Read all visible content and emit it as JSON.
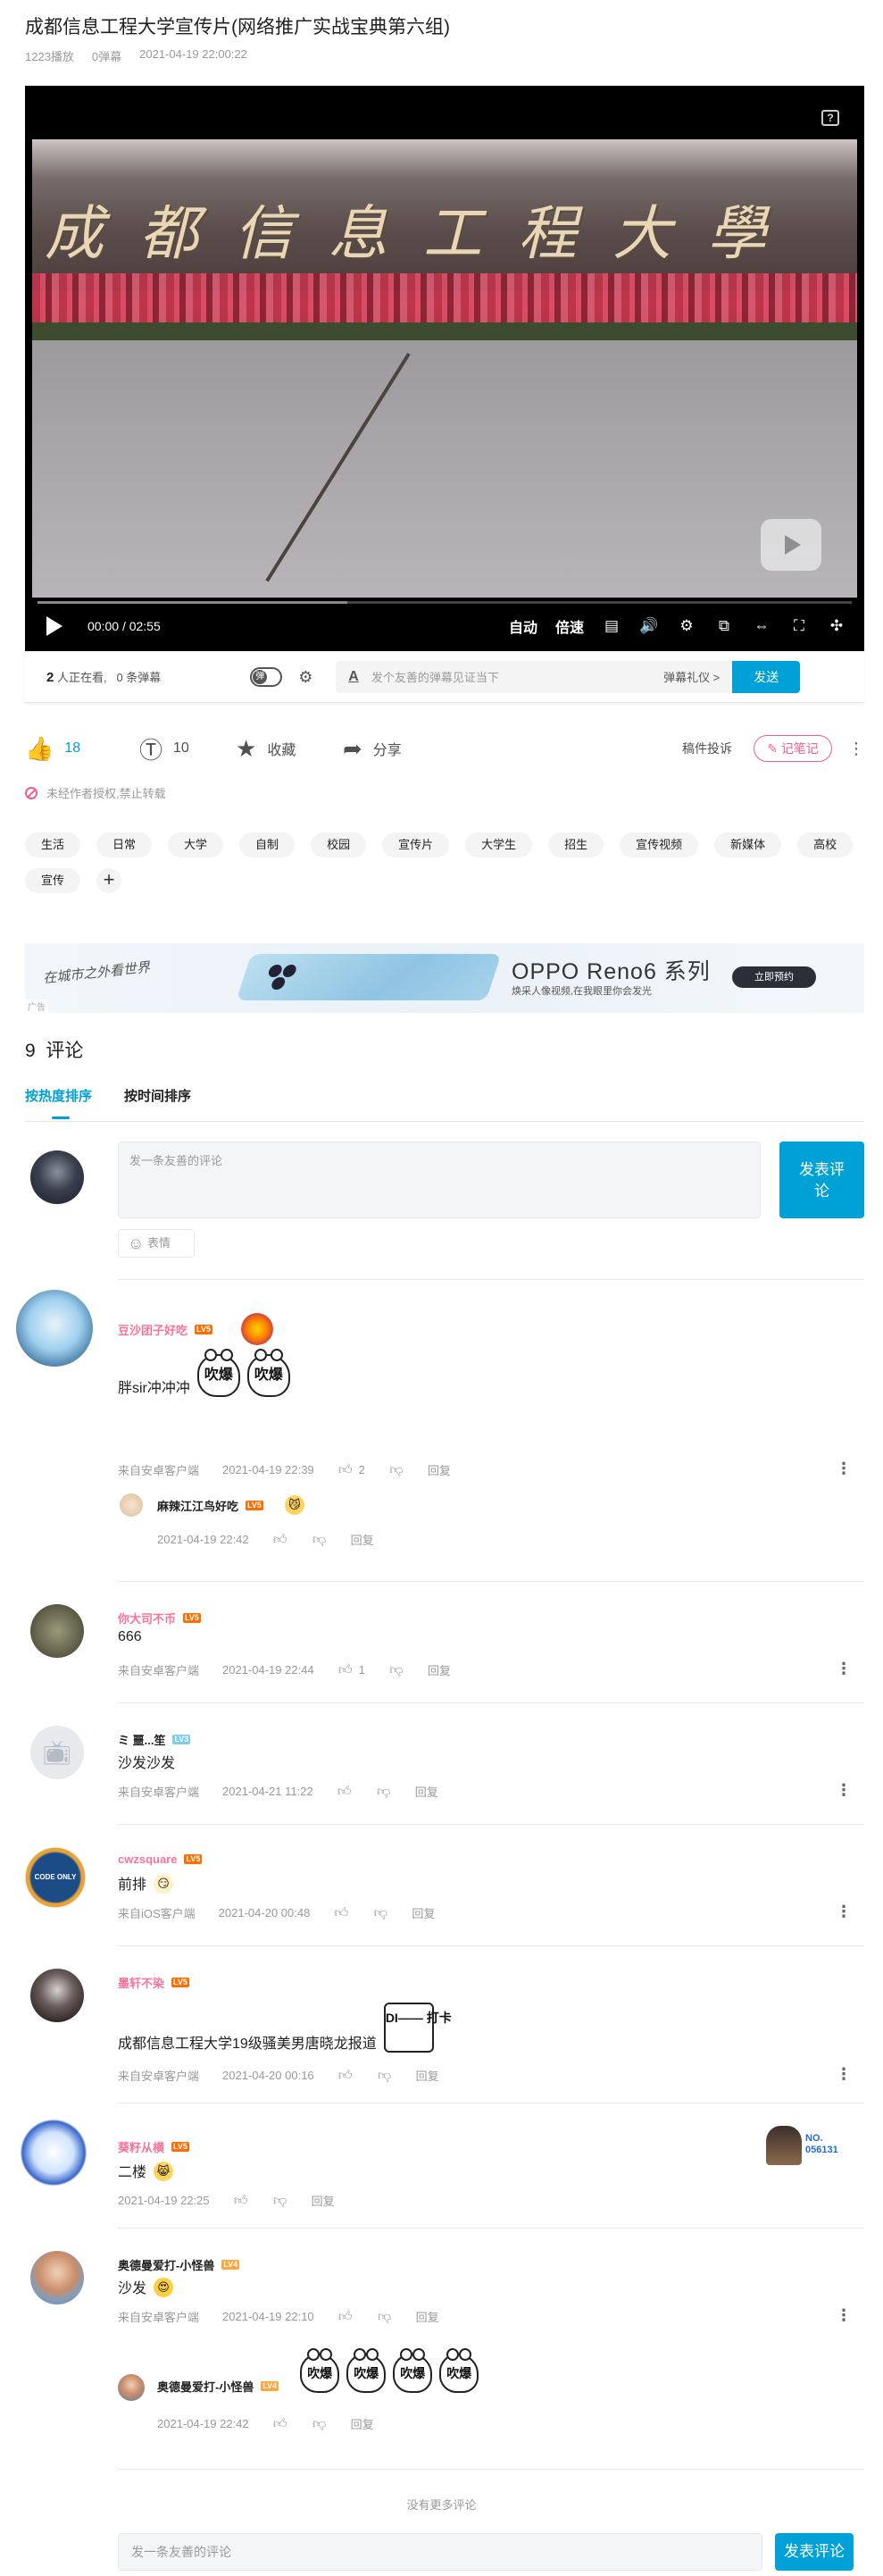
{
  "video": {
    "title": "成都信息工程大学宣传片(网络推广实战宝典第六组)",
    "plays": "1223播放",
    "danmaku_count": "0弹幕",
    "published": "2021-04-19 22:00:22",
    "sign_text": "成都信息工程大學"
  },
  "player": {
    "help_label": "?",
    "current_time": "00:00",
    "time_sep": "/",
    "duration": "02:55",
    "auto_label": "自动",
    "speed_label": "倍速",
    "buffered": 0.38
  },
  "danmaku_bar": {
    "viewers_count": "2",
    "viewers_text": "人正在看,",
    "danmaku_text": "0 条弹幕",
    "input_placeholder": "发个友善的弹幕见证当下",
    "etiquette": "弹幕礼仪 >",
    "send_label": "发送"
  },
  "actions": {
    "likes": "18",
    "coins": "10",
    "favorite_label": "收藏",
    "share_label": "分享",
    "report_label": "稿件投诉",
    "note_label": "记笔记",
    "more_label": "⋮"
  },
  "copyright": "未经作者授权,禁止转载",
  "tags": [
    "生活",
    "日常",
    "大学",
    "自制",
    "校园",
    "宣传片",
    "大学生",
    "招生",
    "宣传视频",
    "新媒体",
    "高校",
    "宣传"
  ],
  "ad": {
    "script_text": "在城市之外看世界",
    "brand": "OPPO Reno6 系列",
    "slogan": "焕采人像视频,在我眼里你会发光",
    "cta": "立即预约",
    "ad_mark": "广告"
  },
  "comments_section": {
    "count": "9",
    "heading": "评论",
    "sort_hot": "按热度排序",
    "sort_time": "按时间排序",
    "composer_placeholder": "发一条友善的评论",
    "composer_post": "发表评论",
    "emoji_label": "表情",
    "no_more": "没有更多评论",
    "bottom_placeholder": "发一条友善的评论",
    "bottom_post": "发表评论"
  },
  "comments": [
    {
      "user": "豆沙团子好吃",
      "level": "LV5",
      "text": "胖sir冲冲冲",
      "stickers": [
        "吹爆",
        "吹爆"
      ],
      "source": "来自安卓客户端",
      "date": "2021-04-19 22:39",
      "likes": "2",
      "reply": "回复",
      "replies": [
        {
          "user": "麻辣江江鸟好吃",
          "level": "LV5",
          "date": "2021-04-19 22:42",
          "reply": "回复"
        }
      ]
    },
    {
      "user": "你大司不币",
      "level": "LV5",
      "text": "666",
      "source": "来自安卓客户端",
      "date": "2021-04-19 22:44",
      "likes": "1",
      "reply": "回复"
    },
    {
      "user": "ミ 噩...笙",
      "level": "LV3",
      "text": "沙发沙发",
      "source": "来自安卓客户端",
      "date": "2021-04-21 11:22",
      "reply": "回复"
    },
    {
      "user": "cwzsquare",
      "level": "LV5",
      "text": "前排",
      "source": "来自iOS客户端",
      "date": "2021-04-20 00:48",
      "reply": "回复",
      "avatar_text": "CODE ONLY"
    },
    {
      "user": "墨轩不染",
      "level": "LV5",
      "text": "成都信息工程大学19级骚美男唐晓龙报道",
      "sticker": "DI—— 打卡",
      "source": "来自安卓客户端",
      "date": "2021-04-20 00:16",
      "reply": "回复"
    },
    {
      "user": "葵籽从横",
      "level": "LV5",
      "text": "二楼",
      "date": "2021-04-19 22:25",
      "reply": "回复",
      "decor": "NO. 056131"
    },
    {
      "user": "奥德曼爱打-小怪兽",
      "level": "LV4",
      "text": "沙发",
      "source": "来自安卓客户端",
      "date": "2021-04-19 22:10",
      "reply": "回复",
      "replies": [
        {
          "user": "奥德曼爱打-小怪兽",
          "level": "LV4",
          "stickers": [
            "吹爆",
            "吹爆",
            "吹爆",
            "吹爆"
          ],
          "date": "2021-04-19 22:42",
          "reply": "回复"
        }
      ]
    }
  ],
  "colors": {
    "accent": "#00a1d6",
    "pink": "#f25d8e"
  }
}
